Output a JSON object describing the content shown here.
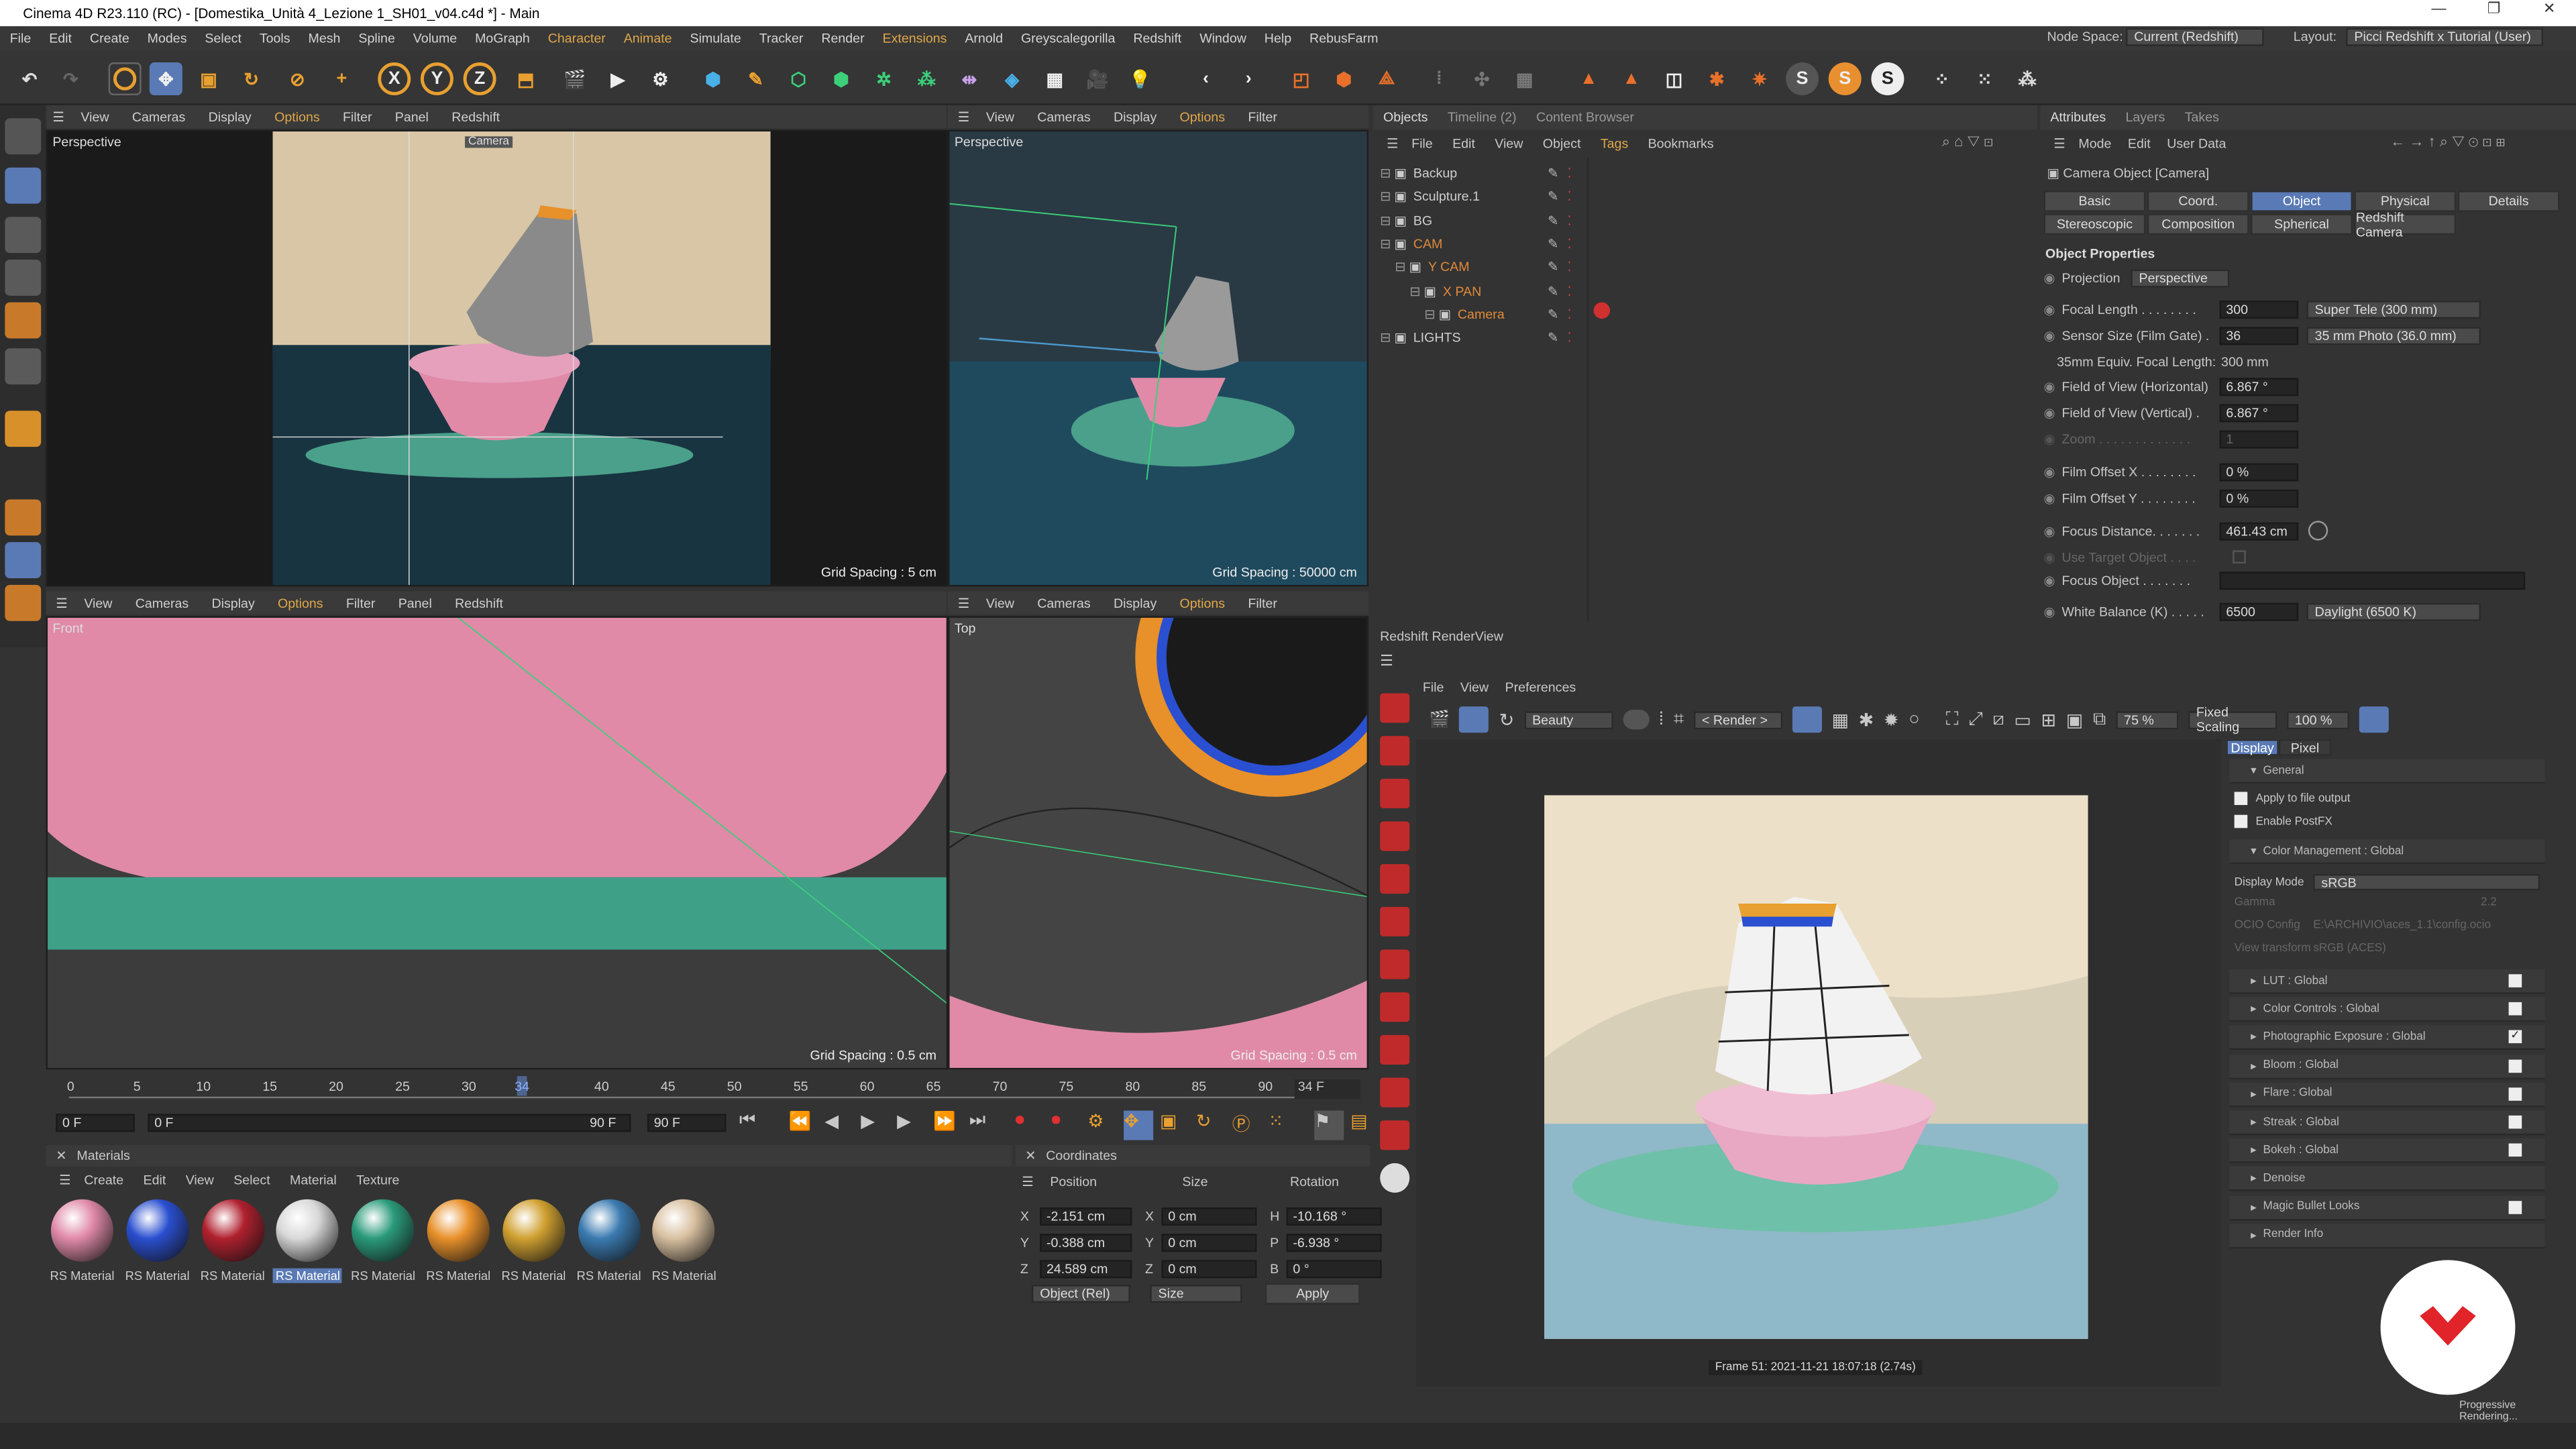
{
  "title": "Cinema 4D R23.110 (RC) - [Domestika_Unità 4_Lezione 1_SH01_v04.c4d *] - Main",
  "menu": [
    "File",
    "Edit",
    "Create",
    "Modes",
    "Select",
    "Tools",
    "Mesh",
    "Spline",
    "Volume",
    "MoGraph",
    "Character",
    "Animate",
    "Simulate",
    "Tracker",
    "Render",
    "Extensions",
    "Arnold",
    "Greyscalegorilla",
    "Redshift",
    "Window",
    "Help",
    "RebusFarm"
  ],
  "node_space_label": "Node Space:",
  "node_space_value": "Current (Redshift)",
  "layout_label": "Layout:",
  "layout_value": "Picci Redshift x Tutorial (User)",
  "toolbar_letters": {
    "x": "X",
    "y": "Y",
    "z": "Z"
  },
  "vp_menu_a": [
    "View",
    "Cameras",
    "Display",
    "Options",
    "Filter",
    "Panel",
    "Redshift"
  ],
  "vp_menu_b": [
    "View",
    "Cameras",
    "Display",
    "Options",
    "Filter"
  ],
  "vp1": {
    "label": "Perspective",
    "camera_tag": "Camera",
    "grid": "Grid Spacing : 5 cm"
  },
  "vp2": {
    "label": "Perspective",
    "grid": "Grid Spacing : 50000 cm"
  },
  "vp3": {
    "label": "Front",
    "grid": "Grid Spacing : 0.5 cm"
  },
  "vp4": {
    "label": "Top",
    "grid": "Grid Spacing : 0.5 cm"
  },
  "objects_tabs": [
    "Objects",
    "Timeline (2)",
    "Content Browser"
  ],
  "objects_menu": [
    "File",
    "Edit",
    "View",
    "Object",
    "Tags",
    "Bookmarks"
  ],
  "objects": [
    {
      "name": "Backup",
      "color": "#cfcfcf",
      "indent": 0
    },
    {
      "name": "Sculpture.1",
      "color": "#cfcfcf",
      "indent": 0
    },
    {
      "name": "BG",
      "color": "#cfcfcf",
      "indent": 0
    },
    {
      "name": "CAM",
      "color": "#e08a3a",
      "indent": 0
    },
    {
      "name": "Y CAM",
      "color": "#e08a3a",
      "indent": 1
    },
    {
      "name": "X PAN",
      "color": "#e08a3a",
      "indent": 2
    },
    {
      "name": "Camera",
      "color": "#e08a3a",
      "indent": 3
    },
    {
      "name": "LIGHTS",
      "color": "#cfcfcf",
      "indent": 0
    }
  ],
  "attr_tabs": [
    "Attributes",
    "Layers",
    "Takes"
  ],
  "attr_menu": [
    "Mode",
    "Edit",
    "User Data"
  ],
  "attr_object": "Camera Object [Camera]",
  "attr_buttons_row1": [
    "Basic",
    "Coord.",
    "Object",
    "Physical",
    "Details"
  ],
  "attr_buttons_row2": [
    "Stereoscopic",
    "Composition",
    "Spherical",
    "Redshift Camera"
  ],
  "obj_props_title": "Object Properties",
  "projection_label": "Projection",
  "projection_value": "Perspective",
  "focal_label": "Focal Length . . . . . . . .",
  "focal_value": "300",
  "focal_preset": "Super Tele (300 mm)",
  "sensor_label": "Sensor Size (Film Gate) .",
  "sensor_value": "36",
  "sensor_preset": "35 mm Photo (36.0 mm)",
  "equiv_label": "35mm Equiv. Focal Length:",
  "equiv_value": "300 mm",
  "fovh_label": "Field of View (Horizontal)",
  "fovh_value": "6.867 °",
  "fovv_label": "Field of View (Vertical) .",
  "fovv_value": "6.867 °",
  "zoom_label": "Zoom . . . . . . . . . . . . .",
  "zoom_value": "1",
  "filmx_label": "Film Offset X . . . . . . . .",
  "filmx_value": "0 %",
  "filmy_label": "Film Offset Y . . . . . . . .",
  "filmy_value": "0 %",
  "focus_label": "Focus Distance. . . . . . .",
  "focus_value": "461.43 cm",
  "target_label": "Use Target Object . . . .",
  "focusobj_label": "Focus Object . . . . . . .",
  "wb_label": "White Balance (K) . . . . .",
  "wb_value": "6500",
  "wb_preset": "Daylight (6500 K)",
  "rs_title": "Redshift RenderView",
  "rs_menu": [
    "File",
    "View",
    "Preferences"
  ],
  "rs_beauty": "Beauty",
  "rs_render": "< Render >",
  "rs_zoom": "75 %",
  "rs_scaling": "Fixed Scaling",
  "rs_pct": "100 %",
  "rs_side_tabs": [
    "Display",
    "Pixel"
  ],
  "rs_general": "General",
  "rs_apply": "Apply to file output",
  "rs_postfx": "Enable PostFX",
  "rs_colormgmt": "Color Management : Global",
  "rs_display_mode_label": "Display Mode",
  "rs_display_mode": "sRGB",
  "rs_gamma_label": "Gamma",
  "rs_gamma": "2.2",
  "rs_ocio_label": "OCIO Config",
  "rs_ocio": "E:\\ARCHIVIO\\aces_1.1\\config.ocio",
  "rs_view_label": "View transform",
  "rs_view": "sRGB (ACES)",
  "rs_sections": [
    {
      "name": "LUT : Global",
      "chk": false
    },
    {
      "name": "Color Controls : Global",
      "chk": false
    },
    {
      "name": "Photographic Exposure : Global",
      "chk": true
    },
    {
      "name": "Bloom : Global",
      "chk": false
    },
    {
      "name": "Flare : Global",
      "chk": false
    },
    {
      "name": "Streak : Global",
      "chk": false
    },
    {
      "name": "Bokeh : Global",
      "chk": false
    },
    {
      "name": "Denoise",
      "chk": null
    },
    {
      "name": "Magic Bullet Looks",
      "chk": false
    },
    {
      "name": "Render Info",
      "chk": null
    }
  ],
  "rs_frame": "Frame 51: 2021-11-21 18:07:18 (2.74s)",
  "rs_status": "Progressive Rendering...",
  "timeline_ticks": [
    "0",
    "5",
    "10",
    "15",
    "20",
    "25",
    "30",
    "34",
    "40",
    "45",
    "50",
    "55",
    "60",
    "65",
    "70",
    "75",
    "80",
    "85",
    "90"
  ],
  "current_frame": "34 F",
  "start_frame": "0 F",
  "min_frame": "0 F",
  "max_frame": "90 F",
  "end_frame": "90 F",
  "materials_title": "Materials",
  "materials_menu": [
    "Create",
    "Edit",
    "View",
    "Select",
    "Material",
    "Texture"
  ],
  "materials": [
    {
      "name": "RS Material",
      "color": "#e08aa8"
    },
    {
      "name": "RS Material",
      "color": "#2a4fd0"
    },
    {
      "name": "RS Material",
      "color": "#b0202e"
    },
    {
      "name": "RS Material",
      "color": "#d8d8d8"
    },
    {
      "name": "RS Material",
      "color": "#2a9a7a"
    },
    {
      "name": "RS Material",
      "color": "#e8902a"
    },
    {
      "name": "RS Material",
      "color": "#d0a030"
    },
    {
      "name": "RS Material",
      "color": "#3a7ab0"
    },
    {
      "name": "RS Material",
      "color": "#d8c0a0"
    }
  ],
  "coords_title": "Coordinates",
  "coords_headers": [
    "Position",
    "Size",
    "Rotation"
  ],
  "coords": [
    {
      "axis": "X",
      "pos": "-2.151 cm",
      "size_axis": "X",
      "size": "0 cm",
      "rot_axis": "H",
      "rot": "-10.168 °"
    },
    {
      "axis": "Y",
      "pos": "-0.388 cm",
      "size_axis": "Y",
      "size": "0 cm",
      "rot_axis": "P",
      "rot": "-6.938 °"
    },
    {
      "axis": "Z",
      "pos": "24.589 cm",
      "size_axis": "Z",
      "size": "0 cm",
      "rot_axis": "B",
      "rot": "0 °"
    }
  ],
  "coords_mode": "Object (Rel)",
  "coords_size": "Size",
  "coords_apply": "Apply",
  "colors": {
    "accent": "#e0a84a",
    "select": "#5a7ab5",
    "bg": "#333333"
  }
}
